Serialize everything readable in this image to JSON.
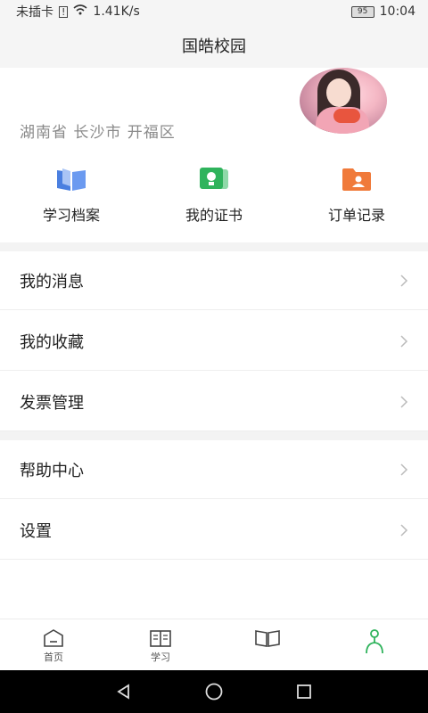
{
  "status": {
    "carrier": "未插卡",
    "speed": "1.41K/s",
    "battery": "95",
    "time": "10:04"
  },
  "header": {
    "title": "国皓校园"
  },
  "profile": {
    "location": "湖南省 长沙市 开福区"
  },
  "quick_actions": [
    {
      "label": "学习档案",
      "icon": "book-icon",
      "color": "#4a7fe0"
    },
    {
      "label": "我的证书",
      "icon": "certificate-icon",
      "color": "#2fb35c"
    },
    {
      "label": "订单记录",
      "icon": "folder-user-icon",
      "color": "#f07a3a"
    }
  ],
  "menu": [
    {
      "label": "我的消息"
    },
    {
      "label": "我的收藏"
    },
    {
      "label": "发票管理"
    },
    {
      "label": "帮助中心"
    },
    {
      "label": "设置"
    }
  ],
  "bottom_nav": [
    {
      "label": "首页",
      "icon": "home-icon"
    },
    {
      "label": "学习",
      "icon": "study-book-icon"
    },
    {
      "label": "",
      "icon": "open-book-icon"
    },
    {
      "label": "",
      "icon": "profile-icon",
      "active_color": "#2fb35c"
    }
  ]
}
